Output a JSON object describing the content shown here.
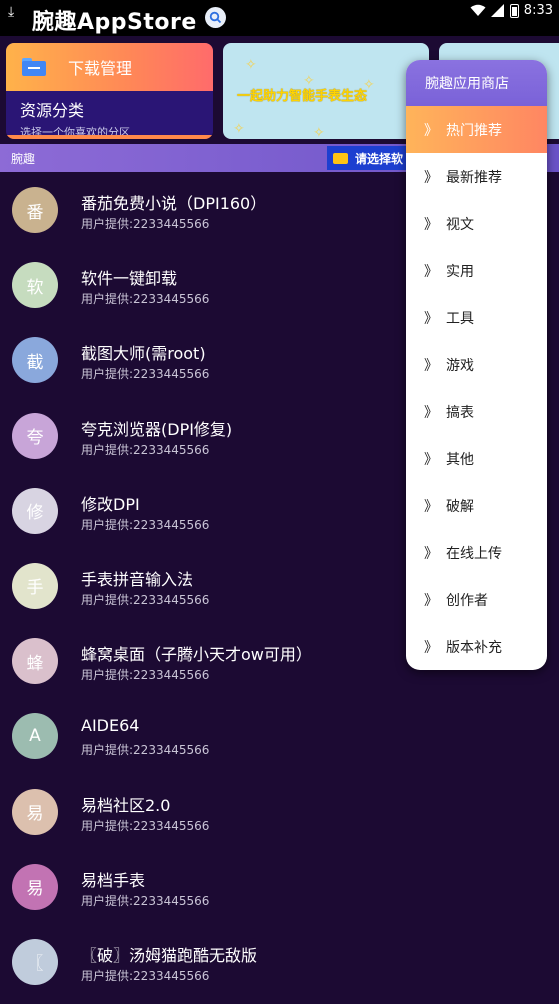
{
  "status_bar": {
    "app_title": "腕趣AppStore",
    "time": "8:33"
  },
  "download_card": {
    "title": "下载管理",
    "category_title": "资源分类",
    "category_subtitle": "选择一个你喜欢的分区"
  },
  "banner": {
    "slogan": "一起助力智能手表生态"
  },
  "breadcrumb": {
    "label": "腕趣",
    "picker_label": "请选择软"
  },
  "colors": {
    "background": "#1c0a33",
    "accent_gradient_start": "#ffb45a",
    "accent_gradient_end": "#ff8662",
    "menu_header": "#8a72e0",
    "picker": "#1d3fd0"
  },
  "apps": [
    {
      "initial": "番",
      "name": "番茄免费小说（DPI160）",
      "provider": "用户提供:2233445566",
      "color": "#c9b28f"
    },
    {
      "initial": "软",
      "name": "软件一键卸载",
      "provider": "用户提供:2233445566",
      "color": "#c6dcbf"
    },
    {
      "initial": "截",
      "name": "截图大师(需root)",
      "provider": "用户提供:2233445566",
      "color": "#8aa8dc"
    },
    {
      "initial": "夸",
      "name": "夸克浏览器(DPI修复)",
      "provider": "用户提供:2233445566",
      "color": "#c8a5d8"
    },
    {
      "initial": "修",
      "name": "修改DPI",
      "provider": "用户提供:2233445566",
      "color": "#d8d4e2"
    },
    {
      "initial": "手",
      "name": "手表拼音输入法",
      "provider": "用户提供:2233445566",
      "color": "#e2e4cc"
    },
    {
      "initial": "蜂",
      "name": "蜂窝桌面（子腾小天才ow可用）",
      "provider": "用户提供:2233445566",
      "color": "#dac0cc"
    },
    {
      "initial": "A",
      "name": "AIDE64",
      "provider": "用户提供:2233445566",
      "color": "#9cbcb0"
    },
    {
      "initial": "易",
      "name": "易档社区2.0",
      "provider": "用户提供:2233445566",
      "color": "#dcc0ae"
    },
    {
      "initial": "易",
      "name": "易档手表",
      "provider": "用户提供:2233445566",
      "color": "#c273b3"
    },
    {
      "initial": "〖",
      "name": "〖破〗汤姆猫跑酷无敌版",
      "provider": "用户提供:2233445566",
      "color": "#c0ccdc"
    }
  ],
  "menu": {
    "title": "腕趣应用商店",
    "arrow": "》",
    "items": [
      {
        "label": "热门推荐",
        "active": true
      },
      {
        "label": "最新推荐",
        "active": false
      },
      {
        "label": "视文",
        "active": false
      },
      {
        "label": "实用",
        "active": false
      },
      {
        "label": "工具",
        "active": false
      },
      {
        "label": "游戏",
        "active": false
      },
      {
        "label": "搞表",
        "active": false
      },
      {
        "label": "其他",
        "active": false
      },
      {
        "label": "破解",
        "active": false
      },
      {
        "label": "在线上传",
        "active": false
      },
      {
        "label": "创作者",
        "active": false
      },
      {
        "label": "版本补充",
        "active": false
      }
    ]
  }
}
